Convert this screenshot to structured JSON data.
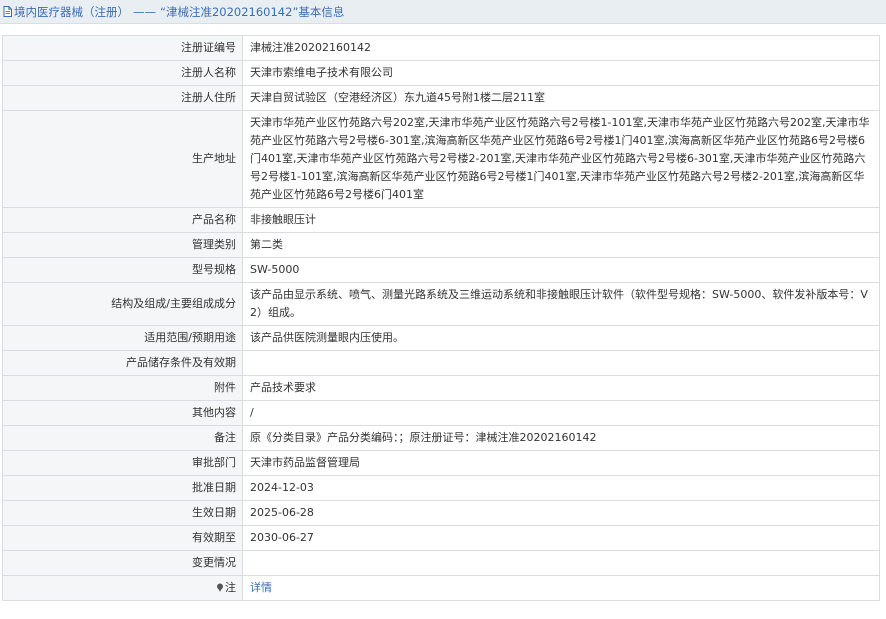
{
  "header": {
    "category": "境内医疗器械（注册）",
    "separator": "——",
    "record_title": "“津械注准20202160142”基本信息"
  },
  "fields": {
    "reg_no": {
      "label": "注册证编号",
      "value": "津械注准20202160142"
    },
    "registrant": {
      "label": "注册人名称",
      "value": "天津市索维电子技术有限公司"
    },
    "registrant_address": {
      "label": "注册人住所",
      "value": "天津自贸试验区（空港经济区）东九道45号附1楼二层211室"
    },
    "production_address": {
      "label": "生产地址",
      "value": "天津市华苑产业区竹苑路六号202室,天津市华苑产业区竹苑路六号2号楼1-101室,天津市华苑产业区竹苑路六号202室,天津市华苑产业区竹苑路六号2号楼6-301室,滨海高新区华苑产业区竹苑路6号2号楼1门401室,滨海高新区华苑产业区竹苑路6号2号楼6门401室,天津市华苑产业区竹苑路六号2号楼2-201室,天津市华苑产业区竹苑路六号2号楼6-301室,天津市华苑产业区竹苑路六号2号楼1-101室,滨海高新区华苑产业区竹苑路6号2号楼1门401室,天津市华苑产业区竹苑路六号2号楼2-201室,滨海高新区华苑产业区竹苑路6号2号楼6门401室"
    },
    "product_name": {
      "label": "产品名称",
      "value": "非接触眼压计"
    },
    "management_class": {
      "label": "管理类别",
      "value": "第二类"
    },
    "model_spec": {
      "label": "型号规格",
      "value": "SW-5000"
    },
    "structure": {
      "label": "结构及组成/主要组成成分",
      "value": "该产品由显示系统、喷气、测量光路系统及三维运动系统和非接触眼压计软件（软件型号规格：SW-5000、软件发补版本号：V2）组成。"
    },
    "intended_use": {
      "label": "适用范围/预期用途",
      "value": "该产品供医院测量眼内压使用。"
    },
    "storage": {
      "label": "产品储存条件及有效期",
      "value": ""
    },
    "attachment": {
      "label": "附件",
      "value": "产品技术要求"
    },
    "other": {
      "label": "其他内容",
      "value": "/"
    },
    "remark": {
      "label": "备注",
      "value": "原《分类目录》产品分类编码：；原注册证号：津械注准20202160142"
    },
    "approval_dept": {
      "label": "审批部门",
      "value": "天津市药品监督管理局"
    },
    "approval_date": {
      "label": "批准日期",
      "value": "2024-12-03"
    },
    "effective_date": {
      "label": "生效日期",
      "value": "2025-06-28"
    },
    "expiry_date": {
      "label": "有效期至",
      "value": "2030-06-27"
    },
    "changes": {
      "label": "变更情况",
      "value": ""
    },
    "note": {
      "label": "注",
      "value": "详情"
    }
  },
  "colors": {
    "link": "#3a6db5",
    "label_bg": "#f4f6f8",
    "border": "#d9dde2",
    "title_bg": "#e9eef3"
  },
  "icons": {
    "title": "document-icon",
    "note": "pin-icon"
  }
}
